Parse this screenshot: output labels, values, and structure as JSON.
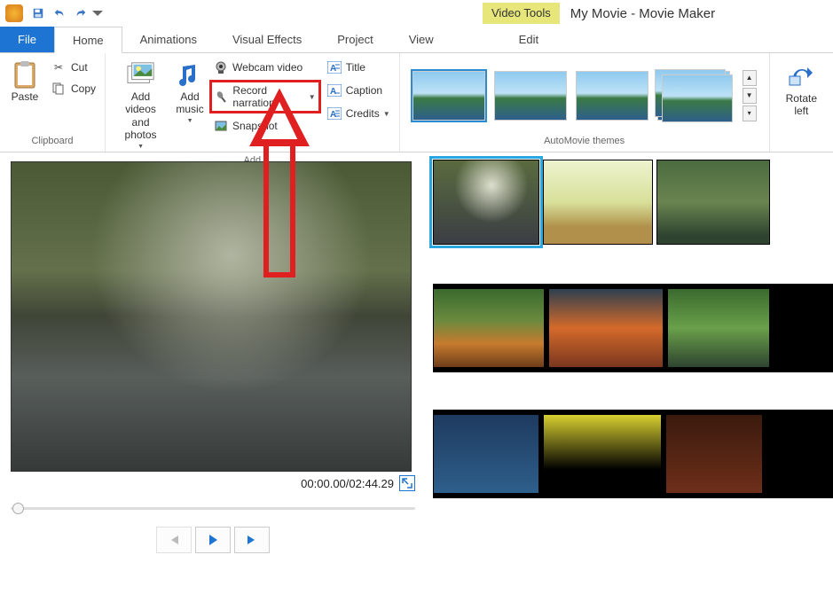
{
  "titlebar": {
    "video_tools": "Video Tools",
    "title": "My Movie - Movie Maker"
  },
  "tabs": {
    "file": "File",
    "home": "Home",
    "animations": "Animations",
    "visual_effects": "Visual Effects",
    "project": "Project",
    "view": "View",
    "edit": "Edit"
  },
  "ribbon": {
    "clipboard": {
      "paste": "Paste",
      "cut": "Cut",
      "copy": "Copy",
      "label": "Clipboard"
    },
    "add": {
      "add_videos": "Add videos\nand photos",
      "add_music": "Add\nmusic",
      "webcam": "Webcam video",
      "record": "Record narration",
      "snapshot": "Snapshot",
      "title_btn": "Title",
      "caption": "Caption",
      "credits": "Credits",
      "label": "Add"
    },
    "automovie": {
      "label": "AutoMovie themes"
    },
    "rotate": {
      "left": "Rotate\nleft"
    }
  },
  "preview": {
    "time": "00:00.00/02:44.29"
  }
}
